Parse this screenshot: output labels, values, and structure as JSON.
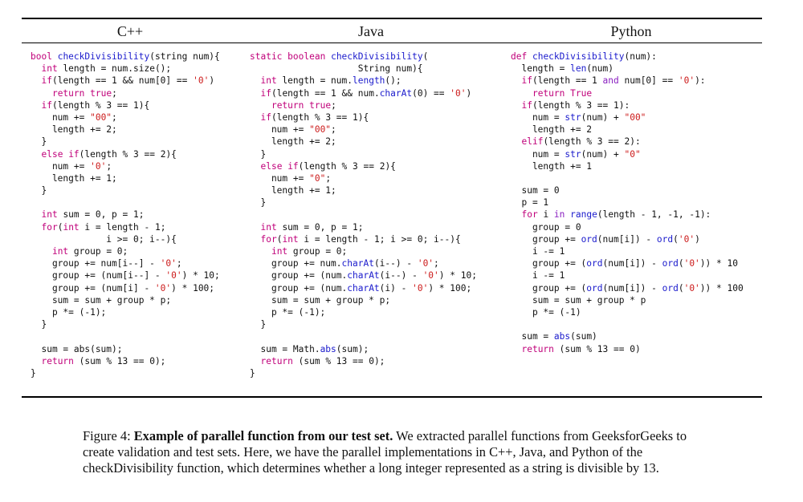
{
  "table": {
    "headers": [
      "C++",
      "Java",
      "Python"
    ]
  },
  "code": {
    "cpp": [
      "bool checkDivisibility(string num){",
      "  int length = num.size();",
      "  if(length == 1 && num[0] == '0')",
      "    return true;",
      "  if(length % 3 == 1){",
      "    num += \"00\";",
      "    length += 2;",
      "  }",
      "  else if(length % 3 == 2){",
      "    num += '0';",
      "    length += 1;",
      "  }",
      "",
      "  int sum = 0, p = 1;",
      "  for(int i = length - 1;",
      "              i >= 0; i--){",
      "    int group = 0;",
      "    group += num[i--] - '0';",
      "    group += (num[i--] - '0') * 10;",
      "    group += (num[i] - '0') * 100;",
      "    sum = sum + group * p;",
      "    p *= (-1);",
      "  }",
      "",
      "  sum = abs(sum);",
      "  return (sum % 13 == 0);",
      "}"
    ],
    "java": [
      "static boolean checkDivisibility(",
      "                    String num){",
      "  int length = num.length();",
      "  if(length == 1 && num.charAt(0) == '0')",
      "    return true;",
      "  if(length % 3 == 1){",
      "    num += \"00\";",
      "    length += 2;",
      "  }",
      "  else if(length % 3 == 2){",
      "    num += \"0\";",
      "    length += 1;",
      "  }",
      "",
      "  int sum = 0, p = 1;",
      "  for(int i = length - 1; i >= 0; i--){",
      "    int group = 0;",
      "    group += num.charAt(i--) - '0';",
      "    group += (num.charAt(i--) - '0') * 10;",
      "    group += (num.charAt(i) - '0') * 100;",
      "    sum = sum + group * p;",
      "    p *= (-1);",
      "  }",
      "",
      "  sum = Math.abs(sum);",
      "  return (sum % 13 == 0);",
      "}"
    ],
    "python": [
      "def checkDivisibility(num):",
      "  length = len(num)",
      "  if(length == 1 and num[0] == '0'):",
      "    return True",
      "  if(length % 3 == 1):",
      "    num = str(num) + \"00\"",
      "    length += 2",
      "  elif(length % 3 == 2):",
      "    num = str(num) + \"0\"",
      "    length += 1",
      "",
      "  sum = 0",
      "  p = 1",
      "  for i in range(length - 1, -1, -1):",
      "    group = 0",
      "    group += ord(num[i]) - ord('0')",
      "    i -= 1",
      "    group += (ord(num[i]) - ord('0')) * 10",
      "    i -= 1",
      "    group += (ord(num[i]) - ord('0')) * 100",
      "    sum = sum + group * p",
      "    p *= (-1)",
      "",
      "  sum = abs(sum)",
      "  return (sum % 13 == 0)"
    ]
  },
  "caption": {
    "label": "Figure 4: ",
    "bold": "Example of parallel function from our test set.",
    "text": " We extracted parallel functions from GeeksforGeeks to create validation and test sets. Here, we have the parallel implementations in C++, Java, and Python of the checkDivisibility function, which determines whether a long integer represented as a string is divisible by 13."
  },
  "colors": {
    "keyword": "#c0007a",
    "function": "#1a1acc",
    "string": "#cc1a1a",
    "python_keyword": "#8a20c0"
  }
}
